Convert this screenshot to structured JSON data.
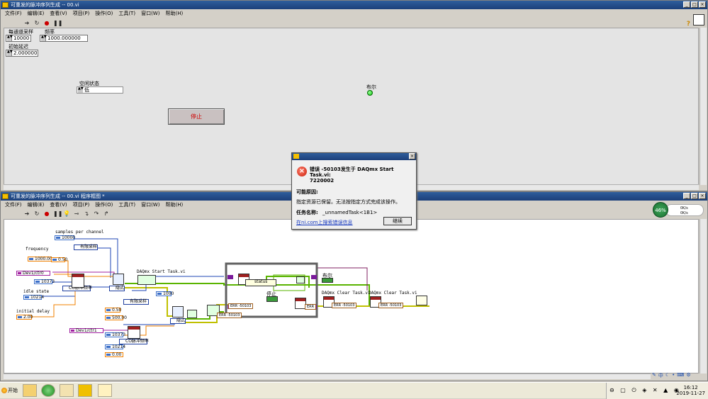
{
  "front_panel": {
    "title": "可重发的脉冲序列生成 -- 00.vi",
    "menu": [
      "文件(F)",
      "编辑(E)",
      "查看(V)",
      "项目(P)",
      "操作(O)",
      "工具(T)",
      "窗口(W)",
      "帮助(H)"
    ],
    "controls": {
      "samples_label": "每通道采样",
      "samples_value": "10000",
      "frequency_label": "频率",
      "frequency_value": "1000.000000",
      "initial_delay_label": "初始延迟",
      "initial_delay_value": "2.000000",
      "idle_state_label": "空闲状态",
      "idle_state_value": "低",
      "bool_label": "布尔",
      "stop_label": "停止"
    }
  },
  "error_dialog": {
    "heading_line1": "错误 -50103发生于 DAQmx Start Task.vi:",
    "heading_line2": "7220002",
    "reason_title": "可能原因:",
    "reason_text": "指定资源已保留。无法按指定方式完成该操作。",
    "task_name_label": "任务名称:",
    "task_name_value": "_unnamedTask<1B1>",
    "search_link": "在ni.com上搜索错误信息",
    "continue_button": "继续"
  },
  "block_diagram": {
    "title": "可重发的脉冲序列生成 -- 00.vi 程序框图 *",
    "menu": [
      "文件(F)",
      "编辑(E)",
      "查看(V)",
      "项目(P)",
      "操作(O)",
      "工具(T)",
      "窗口(W)",
      "帮助(H)"
    ],
    "labels": {
      "samples_per_channel": "samples per channel",
      "frequency": "frequency",
      "idle_state": "idle state",
      "initial_delay": "initial delay",
      "start_task": "DAQmx Start Task.vi",
      "clear_task_1": "DAQmx Clear Task.vi",
      "clear_task_2": "DAQmx Clear Task.vi",
      "bool": "布尔",
      "stop": "停止",
      "status": "status"
    },
    "constants": {
      "c1": "10000",
      "c2": "有限采样",
      "c3": "1000.00",
      "c4": "0.50",
      "c5": "Dev1/ctr0",
      "c6": "10373",
      "c7": "CO脉冲频率",
      "c8": "10214",
      "c9": "2.00",
      "c10": "隐式",
      "c11": "有限采样",
      "c12": "1000",
      "c13": "0.50",
      "c14": "500.00",
      "c15": "Dev1/ctr1",
      "c16": "10373",
      "c17": "CO脉冲频率",
      "c18": "10214",
      "c19": "0.00",
      "c20": "隐式",
      "err1": "-50103",
      "err2": "-50103",
      "err3": "-50103",
      "err4": "-50103",
      "err_tag": "ERR"
    }
  },
  "cpu_widget": {
    "percent": "46%",
    "up": "0K/s",
    "down": "0K/s"
  },
  "taskbar": {
    "start_label": "开始",
    "time": "16:12",
    "date": "2019-11-27"
  }
}
